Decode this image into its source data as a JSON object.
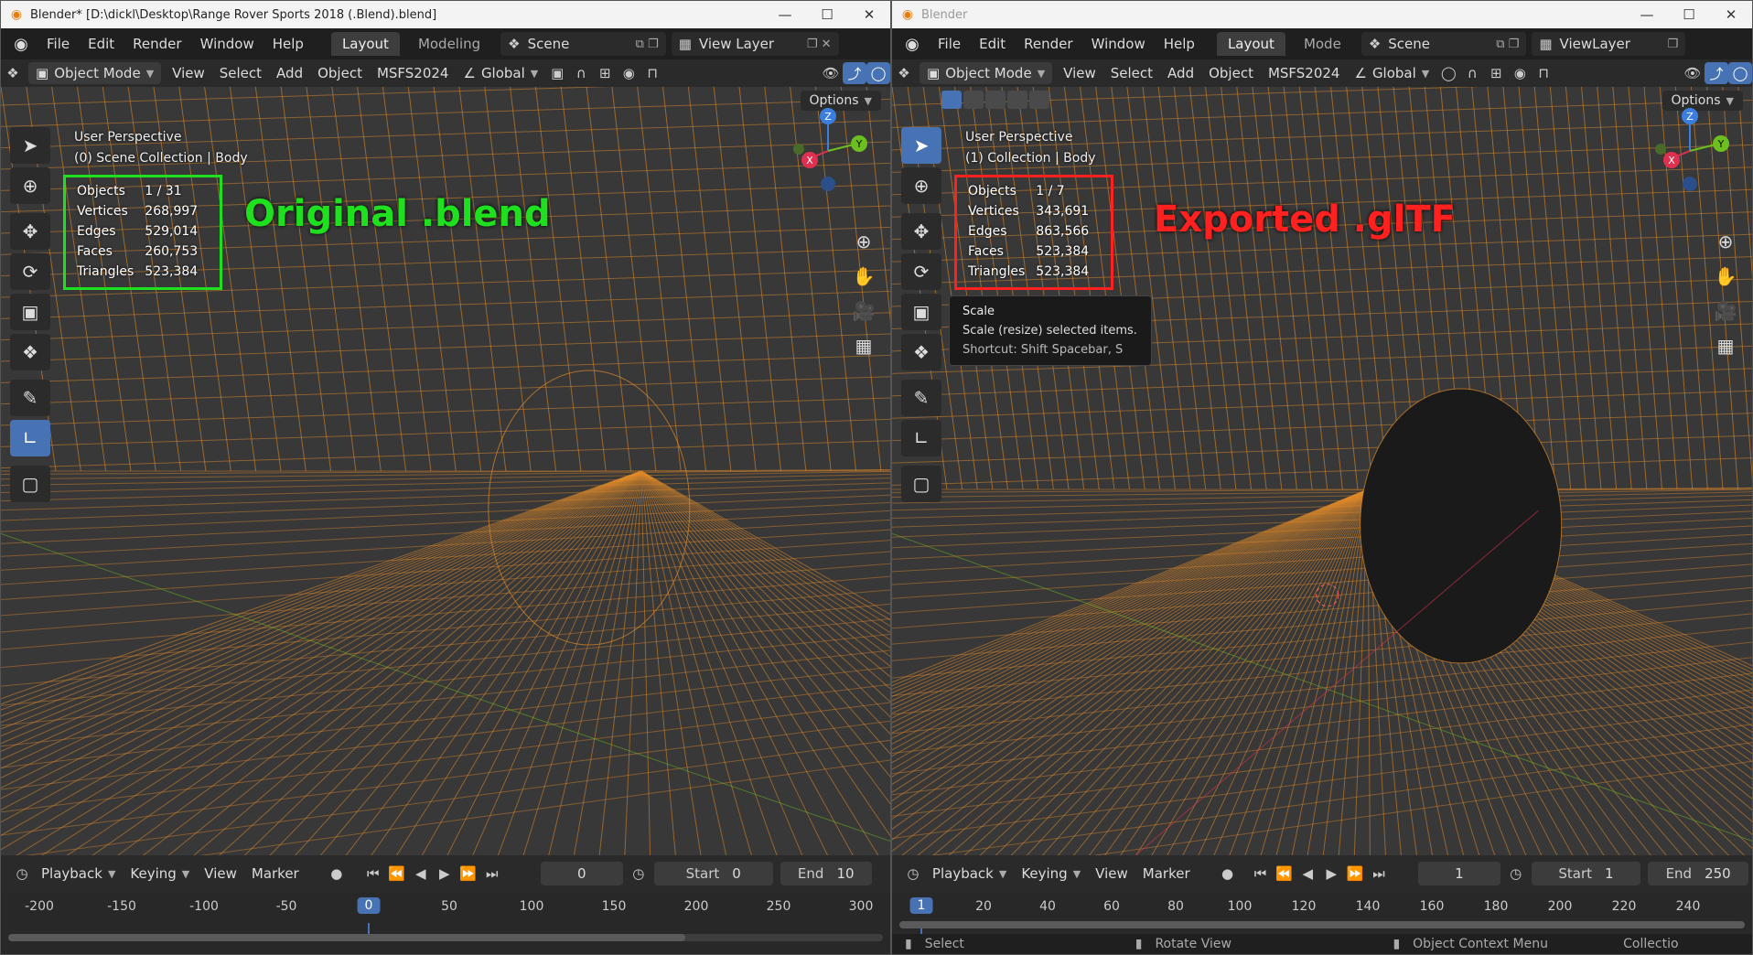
{
  "left": {
    "title": "Blender* [D:\\dickl\\Desktop\\Range Rover Sports 2018 (.Blend).blend]",
    "menu": [
      "File",
      "Edit",
      "Render",
      "Window",
      "Help"
    ],
    "workspaces": [
      "Layout",
      "Modeling"
    ],
    "scene": "Scene",
    "view_layer": "View Layer",
    "mode": "Object Mode",
    "header_menus": [
      "View",
      "Select",
      "Add",
      "Object",
      "MSFS2024"
    ],
    "orientation": "Global",
    "options": "Options",
    "perspective": "User Perspective",
    "collection": "(0) Scene Collection | Body",
    "stats": [
      {
        "label": "Objects",
        "value": "1 / 31"
      },
      {
        "label": "Vertices",
        "value": "268,997"
      },
      {
        "label": "Edges",
        "value": "529,014"
      },
      {
        "label": "Faces",
        "value": "260,753"
      },
      {
        "label": "Triangles",
        "value": "523,384"
      }
    ],
    "annotation": "Original .blend",
    "annotation_color": "#1ee01e",
    "timeline": {
      "menus": [
        "Playback",
        "Keying",
        "View",
        "Marker"
      ],
      "current": "0",
      "start_label": "Start",
      "start": "0",
      "end_label": "End",
      "end": "10",
      "ticks": [
        "-200",
        "-150",
        "-100",
        "-50",
        "0",
        "50",
        "100",
        "150",
        "200",
        "250",
        "300"
      ],
      "cursor": "0"
    }
  },
  "right": {
    "title": "Blender",
    "menu": [
      "File",
      "Edit",
      "Render",
      "Window",
      "Help"
    ],
    "workspaces": [
      "Layout",
      "Mode"
    ],
    "scene": "Scene",
    "view_layer": "ViewLayer",
    "mode": "Object Mode",
    "header_menus": [
      "View",
      "Select",
      "Add",
      "Object",
      "MSFS2024"
    ],
    "orientation": "Global",
    "options": "Options",
    "perspective": "User Perspective",
    "collection": "(1) Collection | Body",
    "stats": [
      {
        "label": "Objects",
        "value": "1 / 7"
      },
      {
        "label": "Vertices",
        "value": "343,691"
      },
      {
        "label": "Edges",
        "value": "863,566"
      },
      {
        "label": "Faces",
        "value": "523,384"
      },
      {
        "label": "Triangles",
        "value": "523,384"
      }
    ],
    "annotation": "Exported .glTF",
    "annotation_color": "#ff2020",
    "tooltip": {
      "title": "Scale",
      "desc": "Scale (resize) selected items.",
      "shortcut": "Shortcut: Shift Spacebar, S"
    },
    "timeline": {
      "menus": [
        "Playback",
        "Keying",
        "View",
        "Marker"
      ],
      "current": "1",
      "start_label": "Start",
      "start": "1",
      "end_label": "End",
      "end": "250",
      "ticks": [
        "20",
        "40",
        "60",
        "80",
        "100",
        "120",
        "140",
        "160",
        "180",
        "200",
        "220",
        "240"
      ],
      "cursor": "1"
    },
    "status": [
      "Select",
      "Rotate View",
      "Object Context Menu",
      "Collectio"
    ]
  },
  "colors": {
    "wire": "#e08a2a",
    "accent": "#4772b3",
    "bg": "#3a3a3a"
  }
}
